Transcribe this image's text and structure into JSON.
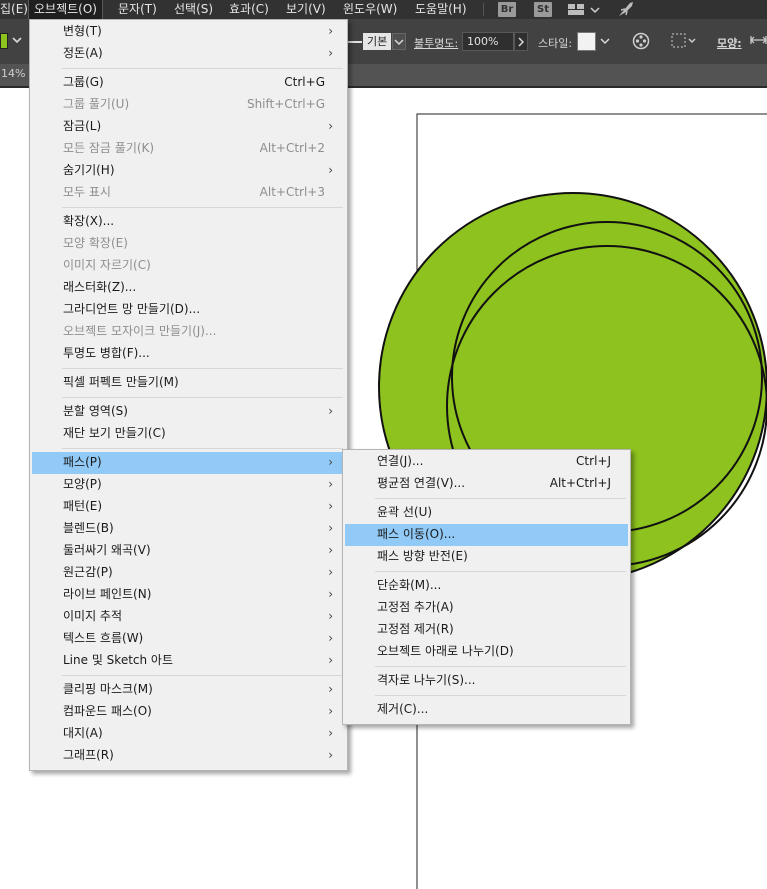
{
  "menubar": {
    "items": [
      "집(E)",
      "오브젝트(O)",
      "문자(T)",
      "선택(S)",
      "효과(C)",
      "보기(V)",
      "윈도우(W)",
      "도움말(H)"
    ],
    "icons": [
      "Br",
      "St"
    ]
  },
  "controlbar": {
    "stroke_label": "기본",
    "opacity_label": "불투명도:",
    "opacity_value": "100%",
    "style_label": "스타일:",
    "shape_label": "모양:",
    "fill_color": "#8dc21f"
  },
  "doc": {
    "zoom_partial": "14%"
  },
  "colors": {
    "circle_fill": "#8dc21f",
    "highlight": "#91c9f7"
  },
  "object_menu": {
    "items": [
      {
        "label": "변형(T)",
        "shortcut": "",
        "submenu": true,
        "disabled": false
      },
      {
        "label": "정돈(A)",
        "shortcut": "",
        "submenu": true,
        "disabled": false
      },
      {
        "label": "그룹(G)",
        "shortcut": "Ctrl+G",
        "submenu": false,
        "disabled": false
      },
      {
        "label": "그룹 풀기(U)",
        "shortcut": "Shift+Ctrl+G",
        "submenu": false,
        "disabled": true
      },
      {
        "label": "잠금(L)",
        "shortcut": "",
        "submenu": true,
        "disabled": false
      },
      {
        "label": "모든 잠금 풀기(K)",
        "shortcut": "Alt+Ctrl+2",
        "submenu": false,
        "disabled": true
      },
      {
        "label": "숨기기(H)",
        "shortcut": "",
        "submenu": true,
        "disabled": false
      },
      {
        "label": "모두 표시",
        "shortcut": "Alt+Ctrl+3",
        "submenu": false,
        "disabled": true
      },
      {
        "label": "확장(X)...",
        "shortcut": "",
        "submenu": false,
        "disabled": false
      },
      {
        "label": "모양 확장(E)",
        "shortcut": "",
        "submenu": false,
        "disabled": true
      },
      {
        "label": "이미지 자르기(C)",
        "shortcut": "",
        "submenu": false,
        "disabled": true
      },
      {
        "label": "래스터화(Z)...",
        "shortcut": "",
        "submenu": false,
        "disabled": false
      },
      {
        "label": "그라디언트 망 만들기(D)...",
        "shortcut": "",
        "submenu": false,
        "disabled": false
      },
      {
        "label": "오브젝트 모자이크 만들기(J)...",
        "shortcut": "",
        "submenu": false,
        "disabled": true
      },
      {
        "label": "투명도 병합(F)...",
        "shortcut": "",
        "submenu": false,
        "disabled": false
      },
      {
        "label": "픽셀 퍼펙트 만들기(M)",
        "shortcut": "",
        "submenu": false,
        "disabled": false
      },
      {
        "label": "분할 영역(S)",
        "shortcut": "",
        "submenu": true,
        "disabled": false
      },
      {
        "label": "재단 보기 만들기(C)",
        "shortcut": "",
        "submenu": false,
        "disabled": false
      },
      {
        "label": "패스(P)",
        "shortcut": "",
        "submenu": true,
        "disabled": false
      },
      {
        "label": "모양(P)",
        "shortcut": "",
        "submenu": true,
        "disabled": false
      },
      {
        "label": "패턴(E)",
        "shortcut": "",
        "submenu": true,
        "disabled": false
      },
      {
        "label": "블렌드(B)",
        "shortcut": "",
        "submenu": true,
        "disabled": false
      },
      {
        "label": "둘러싸기 왜곡(V)",
        "shortcut": "",
        "submenu": true,
        "disabled": false
      },
      {
        "label": "원근감(P)",
        "shortcut": "",
        "submenu": true,
        "disabled": false
      },
      {
        "label": "라이브 페인트(N)",
        "shortcut": "",
        "submenu": true,
        "disabled": false
      },
      {
        "label": "이미지 추적",
        "shortcut": "",
        "submenu": true,
        "disabled": false
      },
      {
        "label": "텍스트 흐름(W)",
        "shortcut": "",
        "submenu": true,
        "disabled": false
      },
      {
        "label": "Line 및 Sketch 아트",
        "shortcut": "",
        "submenu": true,
        "disabled": false
      },
      {
        "label": "클리핑 마스크(M)",
        "shortcut": "",
        "submenu": true,
        "disabled": false
      },
      {
        "label": "컴파운드 패스(O)",
        "shortcut": "",
        "submenu": true,
        "disabled": false
      },
      {
        "label": "대지(A)",
        "shortcut": "",
        "submenu": true,
        "disabled": false
      },
      {
        "label": "그래프(R)",
        "shortcut": "",
        "submenu": true,
        "disabled": false
      }
    ]
  },
  "path_submenu": {
    "items": [
      {
        "label": "연결(J)...",
        "shortcut": "Ctrl+J"
      },
      {
        "label": "평균점 연결(V)...",
        "shortcut": "Alt+Ctrl+J"
      },
      {
        "label": "윤곽 선(U)",
        "shortcut": ""
      },
      {
        "label": "패스 이동(O)...",
        "shortcut": ""
      },
      {
        "label": "패스 방향 반전(E)",
        "shortcut": ""
      },
      {
        "label": "단순화(M)...",
        "shortcut": ""
      },
      {
        "label": "고정점 추가(A)",
        "shortcut": ""
      },
      {
        "label": "고정점 제거(R)",
        "shortcut": ""
      },
      {
        "label": "오브젝트 아래로 나누기(D)",
        "shortcut": ""
      },
      {
        "label": "격자로 나누기(S)...",
        "shortcut": ""
      },
      {
        "label": "제거(C)...",
        "shortcut": ""
      }
    ]
  }
}
